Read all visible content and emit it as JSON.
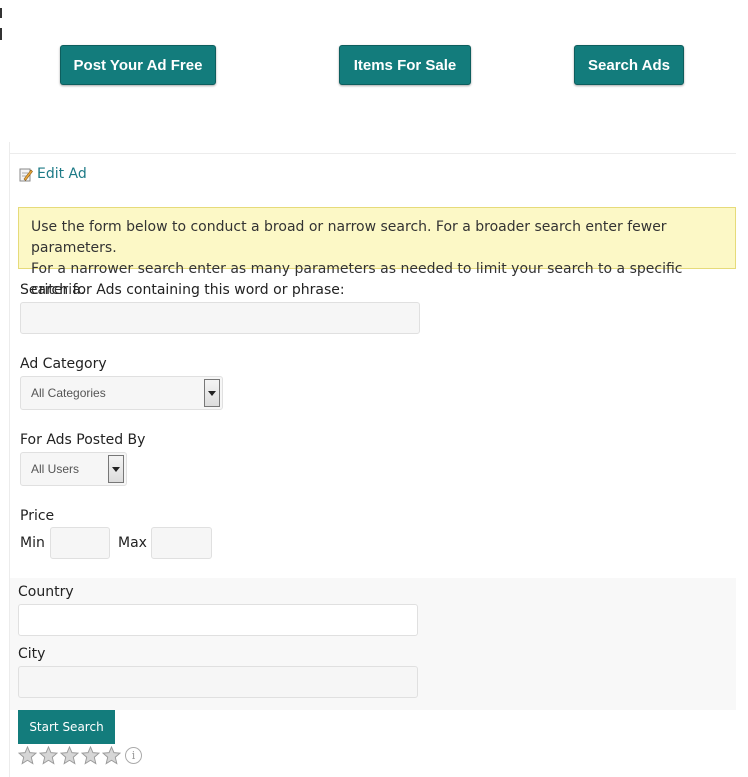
{
  "top_nav": {
    "post_label": "Post Your Ad Free",
    "items_label": "Items For Sale",
    "search_label": "Search Ads"
  },
  "edit_ad": {
    "label": "Edit Ad",
    "icon": "edit-pencil-icon"
  },
  "notice": {
    "line1": "Use the form below to conduct a broad or narrow search. For a broader search enter fewer parameters.",
    "line2": "For a narrower search enter as many parameters as needed to limit your search to a specific criteria."
  },
  "search": {
    "keyword_label": "Search for Ads containing this word or phrase:",
    "keyword_value": "",
    "category_label": "Ad Category",
    "category_value": "All Categories",
    "posted_by_label": "For Ads Posted By",
    "posted_by_value": "All Users",
    "price_label": "Price",
    "min_label": "Min",
    "max_label": "Max",
    "min_value": "",
    "max_value": "",
    "country_label": "Country",
    "country_value": "",
    "city_label": "City",
    "city_value": "",
    "submit_label": "Start Search"
  },
  "rating": {
    "stars": 5,
    "filled": 0,
    "info_glyph": "i"
  },
  "colors": {
    "accent": "#137c7c",
    "link": "#1c7a86",
    "notice_bg": "#fcf8c6"
  }
}
